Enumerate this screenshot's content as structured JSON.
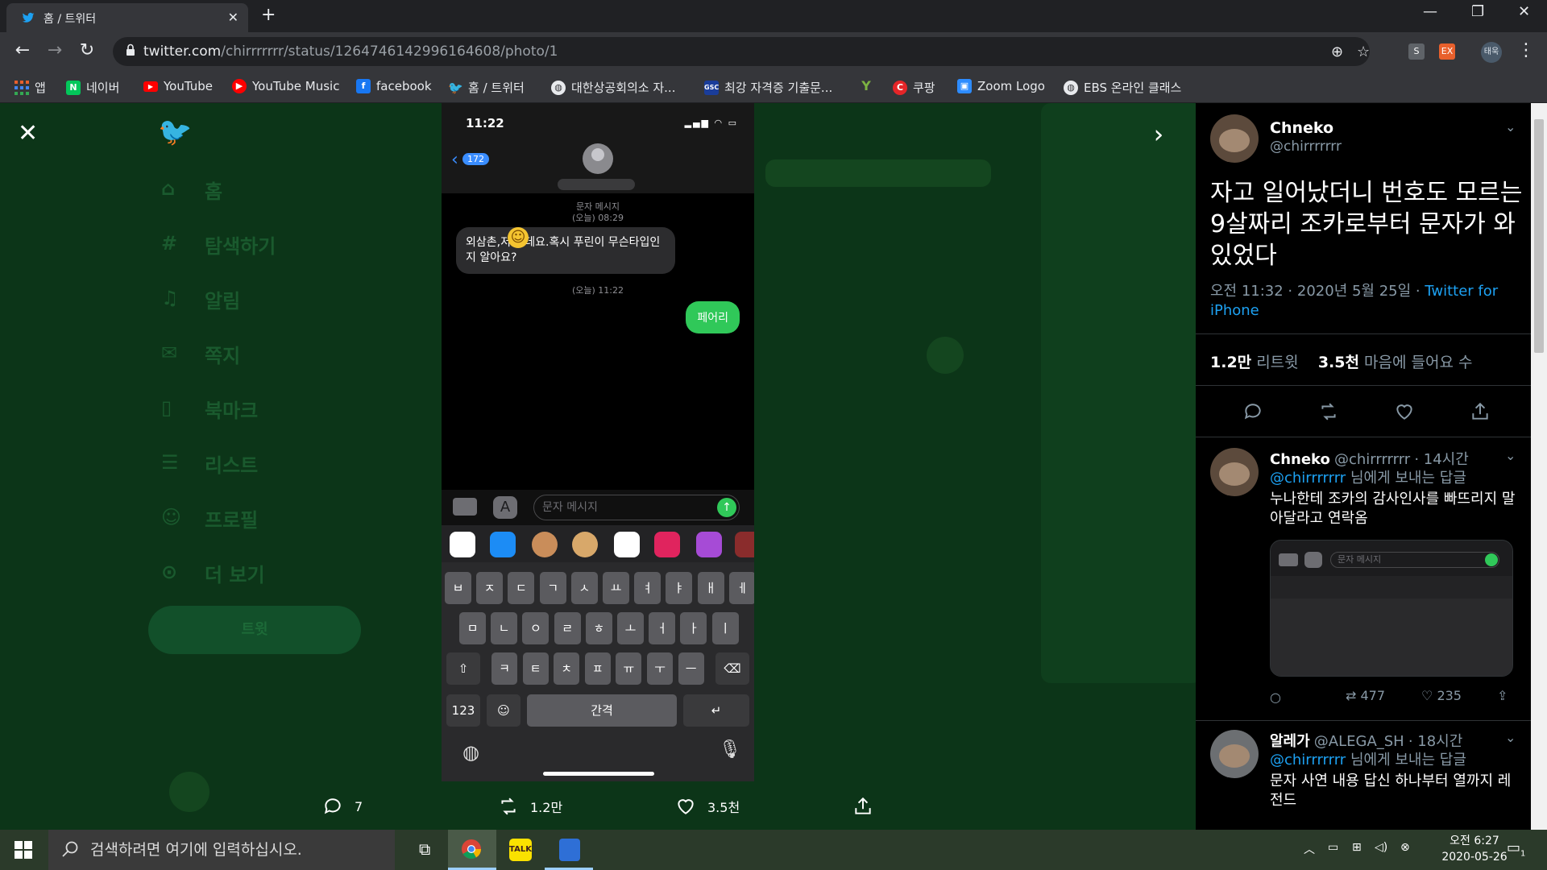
{
  "browser": {
    "tab_title": "홈 / 트위터",
    "url_host": "twitter.com",
    "url_path": "/chirrrrrrr/status/1264746142996164608/photo/1",
    "new_tab": "+",
    "close_tab": "✕",
    "window_min": "—",
    "window_restore": "❐",
    "window_close": "✕",
    "profile_label": "태욱"
  },
  "bookmarks": [
    {
      "label": "앱",
      "icon": "apps-grid-icon"
    },
    {
      "label": "네이버",
      "icon": "naver-icon"
    },
    {
      "label": "YouTube",
      "icon": "youtube-icon"
    },
    {
      "label": "YouTube Music",
      "icon": "youtube-music-icon"
    },
    {
      "label": "facebook",
      "icon": "facebook-icon"
    },
    {
      "label": "홈 / 트위터",
      "icon": "twitter-icon"
    },
    {
      "label": "대한상공회의소 자...",
      "icon": "globe-icon"
    },
    {
      "label": "최강 자격증 기출문...",
      "icon": "gsc-icon"
    },
    {
      "label": "",
      "icon": "y-icon"
    },
    {
      "label": "쿠팡",
      "icon": "coupang-icon"
    },
    {
      "label": "Zoom Logo",
      "icon": "zoom-icon"
    },
    {
      "label": "EBS 온라인 클래스",
      "icon": "globe-icon"
    }
  ],
  "background_nav": [
    "홈",
    "탐색하기",
    "알림",
    "쪽지",
    "북마크",
    "리스트",
    "프로필",
    "더 보기"
  ],
  "background_tweet_button": "트윗",
  "phone": {
    "time": "11:22",
    "badge": "172",
    "msg_type": "문자 메시지",
    "msg_time1": "(오늘) 08:29",
    "incoming": "외삼촌,저  인데요.혹시 푸린이 무슨타입인지 알아요?",
    "msg_time2": "(오늘) 11:22",
    "outgoing": "페어리",
    "input_placeholder": "문자 메시지",
    "keyboard": {
      "row1": [
        "ㅂ",
        "ㅈ",
        "ㄷ",
        "ㄱ",
        "ㅅ",
        "ㅛ",
        "ㅕ",
        "ㅑ",
        "ㅐ",
        "ㅔ"
      ],
      "row2": [
        "ㅁ",
        "ㄴ",
        "ㅇ",
        "ㄹ",
        "ㅎ",
        "ㅗ",
        "ㅓ",
        "ㅏ",
        "ㅣ"
      ],
      "row3": [
        "ㅋ",
        "ㅌ",
        "ㅊ",
        "ㅍ",
        "ㅠ",
        "ㅜ",
        "ㅡ"
      ],
      "key_123": "123",
      "key_space": "간격"
    }
  },
  "viewer_actions": {
    "replies": "7",
    "retweets": "1.2만",
    "likes": "3.5천"
  },
  "panel": {
    "author_name": "Chneko",
    "author_handle": "@chirrrrrrr",
    "tweet_text": "자고 일어났더니 번호도 모르는 9살짜리 조카로부터 문자가 와있었다",
    "meta_time": "오전 11:32 · 2020년 5월 25일 · ",
    "meta_source": "Twitter for iPhone",
    "retweet_count": "1.2만",
    "retweet_label": "리트윗",
    "like_count": "3.5천",
    "like_label": "마음에 들어요 수",
    "reply1": {
      "name": "Chneko",
      "handle": "@chirrrrrrr",
      "time": "· 14시간",
      "mention": "@chirrrrrrr",
      "mention_suffix": "님에게 보내는 답글",
      "text": "누나한테 조카의 감사인사를 빠뜨리지 말아달라고 연락옴",
      "retweets": "477",
      "likes": "235",
      "mini_input": "문자 메시지"
    },
    "reply2": {
      "name": "알레가",
      "handle": "@ALEGA_SH",
      "time": "· 18시간",
      "mention": "@chirrrrrrr",
      "mention_suffix": "님에게 보내는 답글",
      "text": "문자 사연 내용 답신 하나부터 열까지 레전드"
    }
  },
  "taskbar": {
    "search_placeholder": "검색하려면 여기에 입력하십시오.",
    "time": "오전 6:27",
    "date": "2020-05-26",
    "notification_count": "1"
  }
}
